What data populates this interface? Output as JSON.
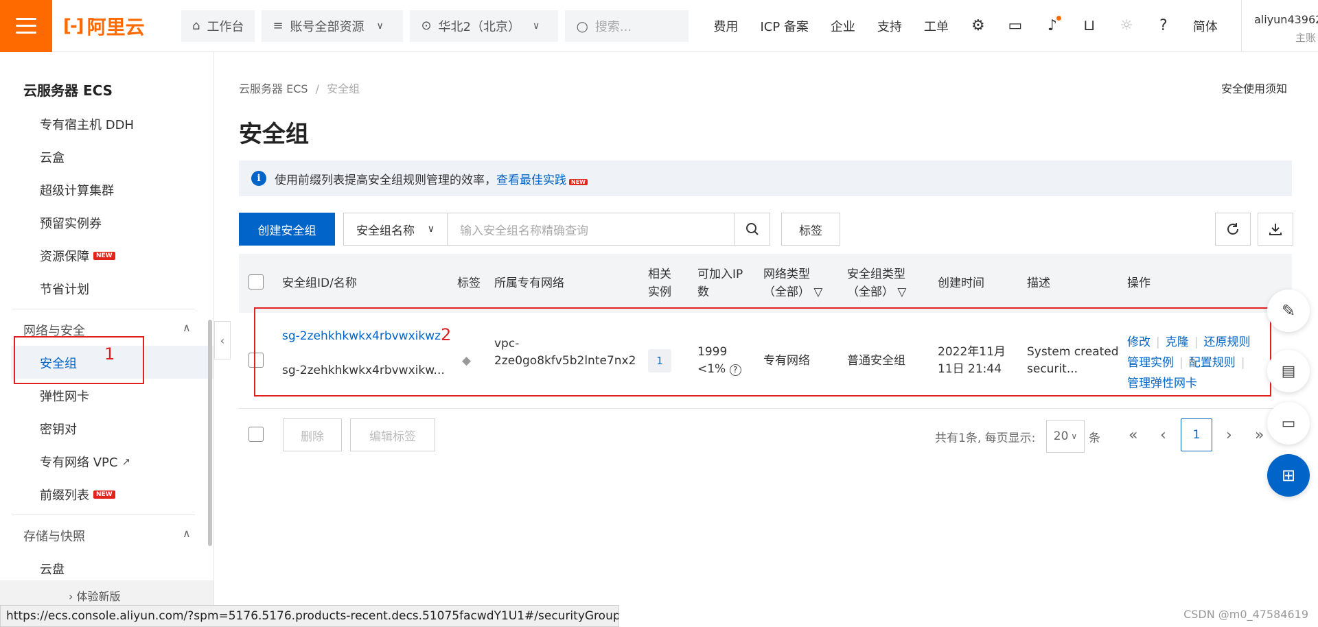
{
  "topbar": {
    "logo_text": "阿里云",
    "workbench": "工作台",
    "resource_scope": "账号全部资源",
    "region": "华北2（北京）",
    "search_placeholder": "搜索...",
    "links": [
      "费用",
      "ICP 备案",
      "企业",
      "支持",
      "工单"
    ],
    "language": "简体",
    "user_name": "aliyun43962",
    "user_sub": "主账"
  },
  "sidebar": {
    "title": "云服务器 ECS",
    "items_top": [
      "专有宿主机 DDH",
      "云盒",
      "超级计算集群",
      "预留实例券",
      "资源保障",
      "节省计划"
    ],
    "new_badge": "NEW",
    "group_network": "网络与安全",
    "items_network": [
      "安全组",
      "弹性网卡",
      "密钥对",
      "专有网络 VPC",
      "前缀列表"
    ],
    "group_storage": "存储与快照",
    "items_storage": [
      "云盘"
    ],
    "footer_text": "体验新版"
  },
  "breadcrumb": {
    "root": "云服务器 ECS",
    "separator": "/",
    "current": "安全组"
  },
  "notice_link": "安全使用须知",
  "page_title": "安全组",
  "info_bar": {
    "text": "使用前缀列表提高安全组规则管理的效率，",
    "link": "查看最佳实践",
    "badge": "NEW"
  },
  "toolbar": {
    "create_button": "创建安全组",
    "filter_select": "安全组名称",
    "search_placeholder": "输入安全组名称精确查询",
    "tag_button": "标签"
  },
  "table": {
    "headers": {
      "id_name": "安全组ID/名称",
      "tag": "标签",
      "vpc": "所属专有网络",
      "instances_l1": "相关",
      "instances_l2": "实例",
      "ip_l1": "可加入IP",
      "ip_l2": "数",
      "net_type_l1": "网络类型",
      "net_type_l2": "（全部）",
      "sg_type_l1": "安全组类型",
      "sg_type_l2": "（全部）",
      "created": "创建时间",
      "desc": "描述",
      "actions": "操作"
    },
    "rows": [
      {
        "id": "sg-2zehkhkwkx4rbvwxikwz",
        "name": "sg-2zehkhkwkx4rbvwxikw...",
        "vpc_l1": "vpc-",
        "vpc_l2": "2ze0go8kfv5b2lnte7nx2",
        "instances": "1",
        "ip_count": "1999",
        "ip_pct": "<1%",
        "net_type": "专有网络",
        "sg_type": "普通安全组",
        "created_l1": "2022年11月",
        "created_l2": "11日 21:44",
        "desc_l1": "System created",
        "desc_l2": "securit...",
        "actions": [
          "修改",
          "克隆",
          "还原规则",
          "管理实例",
          "配置规则",
          "管理弹性网卡"
        ]
      }
    ]
  },
  "footer": {
    "delete_button": "删除",
    "edit_tags_button": "编辑标签",
    "total_text": "共有1条, 每页显示:",
    "page_size": "20",
    "unit": "条",
    "current_page": "1"
  },
  "annotations": [
    "1",
    "2"
  ],
  "status_url": "https://ecs.console.aliyun.com/?spm=5176.5176.products-recent.decs.51075facwdY1U1#/securityGroup/region/",
  "watermark": "CSDN @m0_47584619"
}
